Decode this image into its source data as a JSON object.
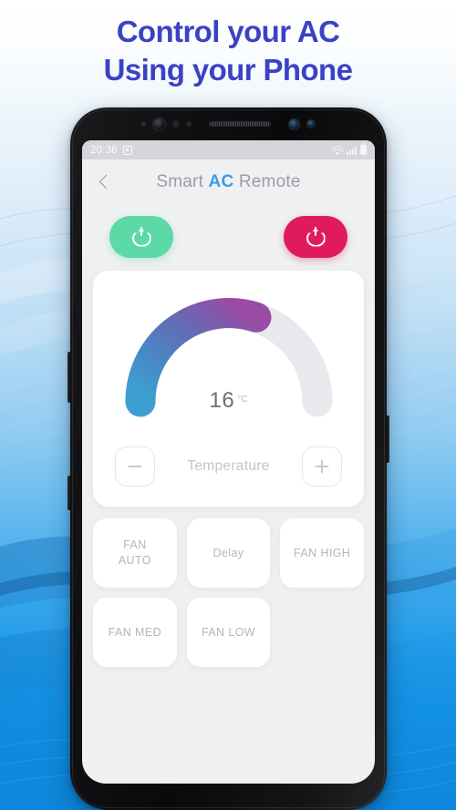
{
  "headline": {
    "line1": "Control your AC",
    "line2": "Using your Phone",
    "color": "#3a43c4"
  },
  "status_bar": {
    "clock": "20:36",
    "sim_icon": "sim-card-icon",
    "wifi_icon": "wifi-icon",
    "signal_icon": "cellular-signal-icon",
    "battery_icon": "battery-icon"
  },
  "app_bar": {
    "back_icon": "chevron-left-icon",
    "title_part1": "Smart ",
    "title_accent": "AC",
    "title_part2": " Remote",
    "accent_color": "#3a9fe0"
  },
  "power": {
    "on_label": "power-on",
    "off_label": "power-off",
    "on_color": "#5cd9a6",
    "off_color": "#e01a5f",
    "icon": "power-icon"
  },
  "temperature": {
    "value": "16",
    "unit": "°C",
    "label": "Temperature",
    "decrease_label": "minus-icon",
    "increase_label": "plus-icon",
    "gauge": {
      "percent": 60,
      "min": 16,
      "max": 30,
      "gradient_start": "#3d9fd0",
      "gradient_mid": "#5f6fb8",
      "gradient_end": "#9b4ba3",
      "track_color": "#e8e9ed"
    }
  },
  "modes": [
    {
      "label": "FAN\nAUTO",
      "name": "mode-fan-auto"
    },
    {
      "label": "Delay",
      "name": "mode-delay"
    },
    {
      "label": "FAN HIGH",
      "name": "mode-fan-high"
    },
    {
      "label": "FAN MED",
      "name": "mode-fan-med"
    },
    {
      "label": "FAN LOW",
      "name": "mode-fan-low"
    }
  ]
}
